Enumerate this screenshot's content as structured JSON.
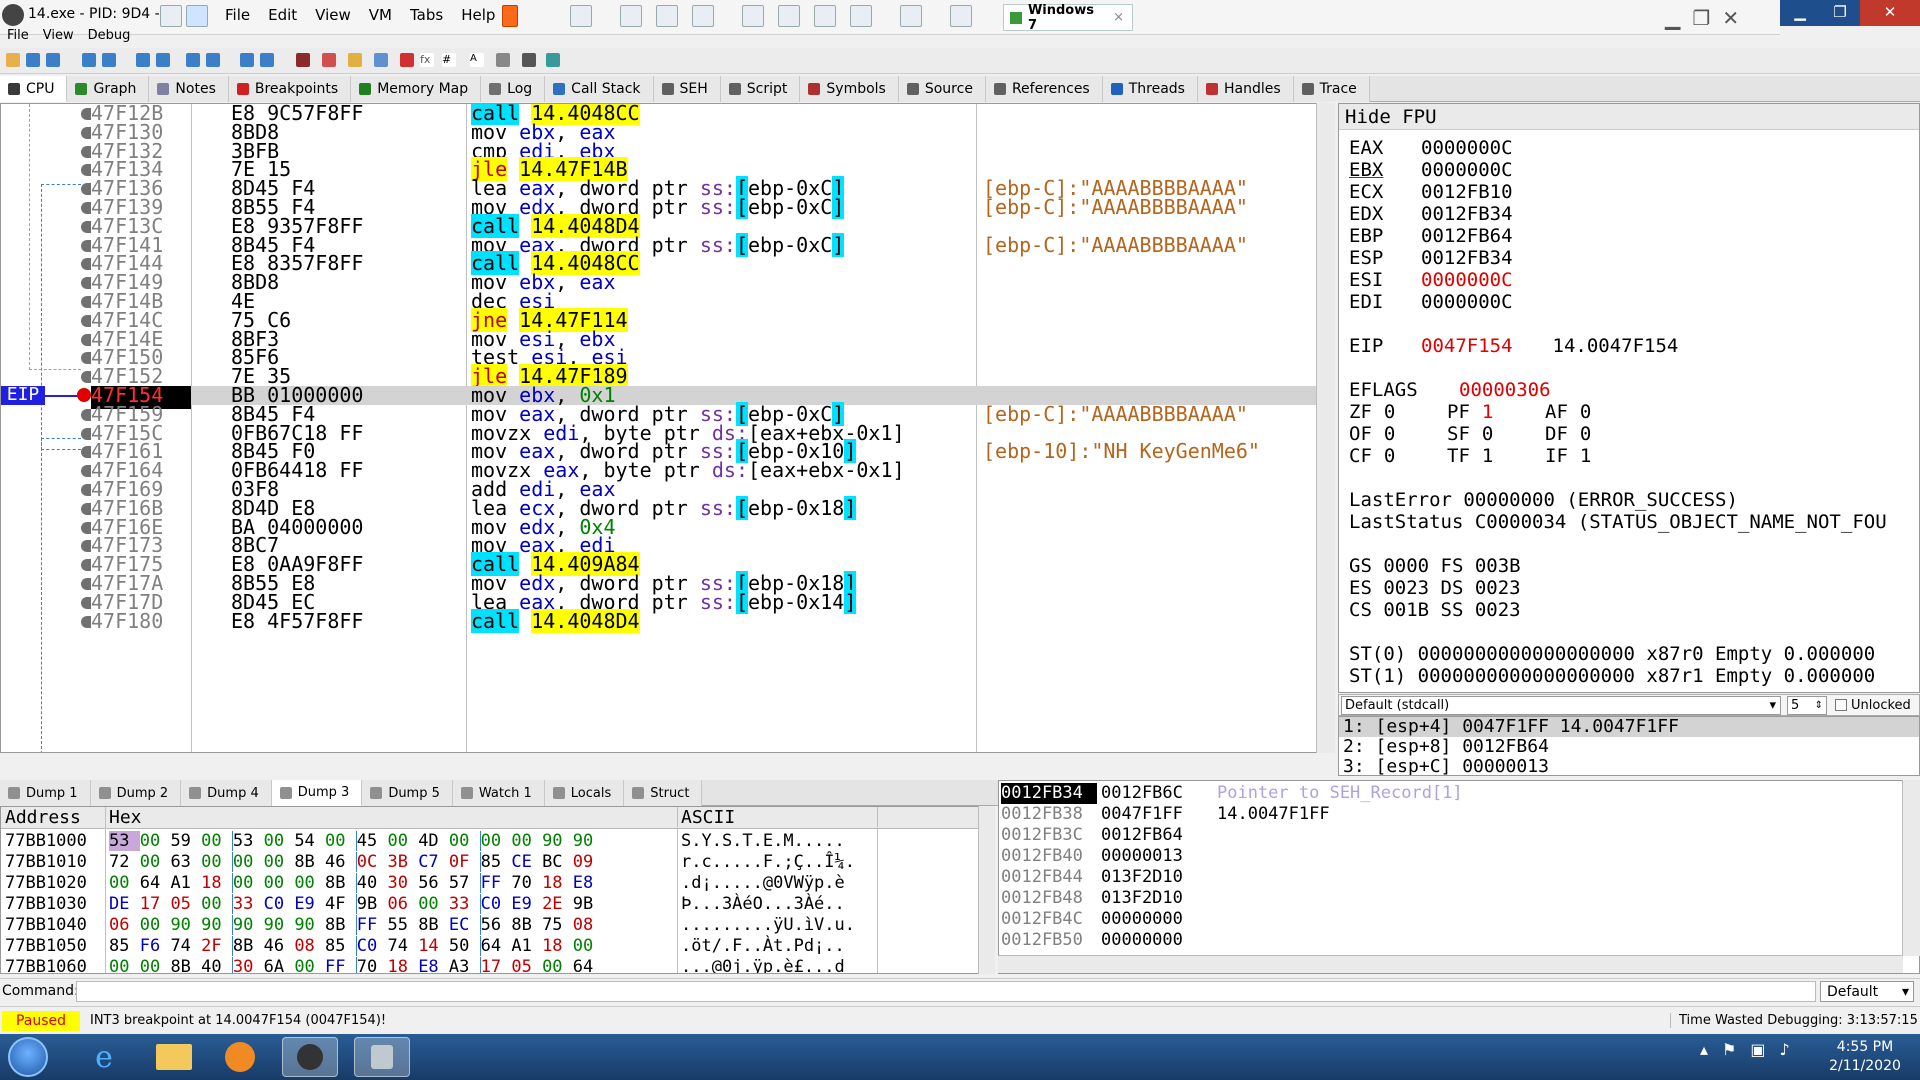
{
  "window": {
    "title": "14.exe - PID: 9D4 -",
    "menu": [
      "File",
      "Edit",
      "View",
      "VM",
      "Tabs",
      "Help"
    ],
    "vm_tab": "Windows 7"
  },
  "app_menu": [
    "File",
    "View",
    "Debug"
  ],
  "main_tabs": [
    {
      "label": "CPU",
      "icon": "cpu-icon",
      "color": "#3a3a3a"
    },
    {
      "label": "Graph",
      "icon": "graph-icon",
      "color": "#2a8a2a"
    },
    {
      "label": "Notes",
      "icon": "notes-icon",
      "color": "#8080a0"
    },
    {
      "label": "Breakpoints",
      "icon": "breakpoint-icon",
      "color": "#d02020"
    },
    {
      "label": "Memory Map",
      "icon": "memory-map-icon",
      "color": "#208020"
    },
    {
      "label": "Log",
      "icon": "log-icon",
      "color": "#707070"
    },
    {
      "label": "Call Stack",
      "icon": "call-stack-icon",
      "color": "#3070c0"
    },
    {
      "label": "SEH",
      "icon": "seh-icon",
      "color": "#606060"
    },
    {
      "label": "Script",
      "icon": "script-icon",
      "color": "#606060"
    },
    {
      "label": "Symbols",
      "icon": "symbols-icon",
      "color": "#b03030"
    },
    {
      "label": "Source",
      "icon": "source-icon",
      "color": "#606060"
    },
    {
      "label": "References",
      "icon": "references-icon",
      "color": "#606060"
    },
    {
      "label": "Threads",
      "icon": "threads-icon",
      "color": "#2060c0"
    },
    {
      "label": "Handles",
      "icon": "handles-icon",
      "color": "#c03030"
    },
    {
      "label": "Trace",
      "icon": "trace-icon",
      "color": "#606060"
    }
  ],
  "disasm": {
    "eip_label": "EIP",
    "rows": [
      {
        "addr": "47F12B",
        "bytes": "E8 9C57F8FF",
        "mn": "call",
        "op": "14.4048CC",
        "type": "call",
        "comment": ""
      },
      {
        "addr": "47F130",
        "bytes": "8BD8",
        "mn": "mov",
        "op": "ebx, eax",
        "type": "plain",
        "comment": ""
      },
      {
        "addr": "47F132",
        "bytes": "3BFB",
        "mn": "cmp",
        "op": "edi, ebx",
        "type": "plain",
        "comment": ""
      },
      {
        "addr": "47F134",
        "bytes": "7E 15",
        "mn": "jle",
        "op": "14.47F14B",
        "type": "jmp",
        "comment": ""
      },
      {
        "addr": "47F136",
        "bytes": "8D45 F4",
        "mn": "lea",
        "op": "eax, dword ptr ss:[ebp-0xC]",
        "type": "plain",
        "comment": "[ebp-C]:\"AAAABBBBAAAA\""
      },
      {
        "addr": "47F139",
        "bytes": "8B55 F4",
        "mn": "mov",
        "op": "edx, dword ptr ss:[ebp-0xC]",
        "type": "plain",
        "comment": "[ebp-C]:\"AAAABBBBAAAA\""
      },
      {
        "addr": "47F13C",
        "bytes": "E8 9357F8FF",
        "mn": "call",
        "op": "14.4048D4",
        "type": "call",
        "comment": ""
      },
      {
        "addr": "47F141",
        "bytes": "8B45 F4",
        "mn": "mov",
        "op": "eax, dword ptr ss:[ebp-0xC]",
        "type": "plain",
        "comment": "[ebp-C]:\"AAAABBBBAAAA\""
      },
      {
        "addr": "47F144",
        "bytes": "E8 8357F8FF",
        "mn": "call",
        "op": "14.4048CC",
        "type": "call",
        "comment": ""
      },
      {
        "addr": "47F149",
        "bytes": "8BD8",
        "mn": "mov",
        "op": "ebx, eax",
        "type": "plain",
        "comment": ""
      },
      {
        "addr": "47F14B",
        "bytes": "4E",
        "mn": "dec",
        "op": "esi",
        "type": "plain",
        "comment": ""
      },
      {
        "addr": "47F14C",
        "bytes": "75 C6",
        "mn": "jne",
        "op": "14.47F114",
        "type": "jmp",
        "comment": ""
      },
      {
        "addr": "47F14E",
        "bytes": "8BF3",
        "mn": "mov",
        "op": "esi, ebx",
        "type": "plain",
        "comment": ""
      },
      {
        "addr": "47F150",
        "bytes": "85F6",
        "mn": "test",
        "op": "esi, esi",
        "type": "plain",
        "comment": ""
      },
      {
        "addr": "47F152",
        "bytes": "7E 35",
        "mn": "jle",
        "op": "14.47F189",
        "type": "jmp",
        "comment": ""
      },
      {
        "addr": "47F154",
        "bytes": "BB 01000000",
        "mn": "mov",
        "op": "ebx, 0x1",
        "type": "plain",
        "comment": "",
        "eip": true
      },
      {
        "addr": "47F159",
        "bytes": "8B45 F4",
        "mn": "mov",
        "op": "eax, dword ptr ss:[ebp-0xC]",
        "type": "plain",
        "comment": "[ebp-C]:\"AAAABBBBAAAA\""
      },
      {
        "addr": "47F15C",
        "bytes": "0FB67C18 FF",
        "mn": "movzx",
        "op": "edi, byte ptr ds:[eax+ebx-0x1]",
        "type": "plain",
        "comment": ""
      },
      {
        "addr": "47F161",
        "bytes": "8B45 F0",
        "mn": "mov",
        "op": "eax, dword ptr ss:[ebp-0x10]",
        "type": "plain",
        "comment": "[ebp-10]:\"NH KeyGenMe6\""
      },
      {
        "addr": "47F164",
        "bytes": "0FB64418 FF",
        "mn": "movzx",
        "op": "eax, byte ptr ds:[eax+ebx-0x1]",
        "type": "plain",
        "comment": ""
      },
      {
        "addr": "47F169",
        "bytes": "03F8",
        "mn": "add",
        "op": "edi, eax",
        "type": "plain",
        "comment": ""
      },
      {
        "addr": "47F16B",
        "bytes": "8D4D E8",
        "mn": "lea",
        "op": "ecx, dword ptr ss:[ebp-0x18]",
        "type": "plain",
        "comment": ""
      },
      {
        "addr": "47F16E",
        "bytes": "BA 04000000",
        "mn": "mov",
        "op": "edx, 0x4",
        "type": "plain",
        "comment": ""
      },
      {
        "addr": "47F173",
        "bytes": "8BC7",
        "mn": "mov",
        "op": "eax, edi",
        "type": "plain",
        "comment": ""
      },
      {
        "addr": "47F175",
        "bytes": "E8 0AA9F8FF",
        "mn": "call",
        "op": "14.409A84",
        "type": "call",
        "comment": ""
      },
      {
        "addr": "47F17A",
        "bytes": "8B55 E8",
        "mn": "mov",
        "op": "edx, dword ptr ss:[ebp-0x18]",
        "type": "plain",
        "comment": ""
      },
      {
        "addr": "47F17D",
        "bytes": "8D45 EC",
        "mn": "lea",
        "op": "eax, dword ptr ss:[ebp-0x14]",
        "type": "plain",
        "comment": ""
      },
      {
        "addr": "47F180",
        "bytes": "E8 4F57F8FF",
        "mn": "call",
        "op": "14.4048D4",
        "type": "call",
        "comment": ""
      }
    ]
  },
  "registers": {
    "header": "Hide FPU",
    "gpr": [
      {
        "name": "EAX",
        "value": "0000000C",
        "changed": false
      },
      {
        "name": "EBX",
        "value": "0000000C",
        "changed": false
      },
      {
        "name": "ECX",
        "value": "0012FB10",
        "changed": false
      },
      {
        "name": "EDX",
        "value": "0012FB34",
        "changed": false
      },
      {
        "name": "EBP",
        "value": "0012FB64",
        "changed": false
      },
      {
        "name": "ESP",
        "value": "0012FB34",
        "changed": false
      },
      {
        "name": "ESI",
        "value": "0000000C",
        "changed": true
      },
      {
        "name": "EDI",
        "value": "0000000C",
        "changed": false
      }
    ],
    "eip": {
      "name": "EIP",
      "value": "0047F154",
      "label": "14.0047F154"
    },
    "eflags": {
      "name": "EFLAGS",
      "value": "00000306"
    },
    "flags_rows": [
      [
        {
          "n": "ZF",
          "v": "0"
        },
        {
          "n": "PF",
          "v": "1",
          "changed": true
        },
        {
          "n": "AF",
          "v": "0"
        }
      ],
      [
        {
          "n": "OF",
          "v": "0"
        },
        {
          "n": "SF",
          "v": "0"
        },
        {
          "n": "DF",
          "v": "0"
        }
      ],
      [
        {
          "n": "CF",
          "v": "0"
        },
        {
          "n": "TF",
          "v": "1"
        },
        {
          "n": "IF",
          "v": "1"
        }
      ]
    ],
    "last_error": "LastError  00000000 (ERROR_SUCCESS)",
    "last_status": "LastStatus C0000034 (STATUS_OBJECT_NAME_NOT_FOU",
    "segs": [
      "GS 0000  FS 003B",
      "ES 0023  DS 0023",
      "CS 001B  SS 0023"
    ],
    "fpu": [
      "ST(0) 0000000000000000000 x87r0 Empty 0.000000",
      "ST(1) 0000000000000000000 x87r1 Empty 0.000000"
    ]
  },
  "callconv": {
    "selected": "Default (stdcall)",
    "count": "5",
    "unlocked": "Unlocked"
  },
  "stack_args": [
    "1: [esp+4] 0047F1FF 14.0047F1FF",
    "2: [esp+8] 0012FB64",
    "3: [esp+C] 00000013"
  ],
  "dump_tabs": [
    {
      "label": "Dump 1",
      "active": false
    },
    {
      "label": "Dump 2",
      "active": false
    },
    {
      "label": "Dump 4",
      "active": false
    },
    {
      "label": "Dump 3",
      "active": true
    },
    {
      "label": "Dump 5",
      "active": false
    },
    {
      "label": "Watch 1",
      "active": false
    },
    {
      "label": "Locals",
      "active": false
    },
    {
      "label": "Struct",
      "active": false
    }
  ],
  "dump": {
    "col_address": "Address",
    "col_hex": "Hex",
    "col_ascii": "ASCII",
    "rows": [
      {
        "addr": "77BB1000",
        "hex": "53 00 59 00 53 00 54 00 45 00 4D 00 00 00 90 90",
        "ascii": "S.Y.S.T.E.M....."
      },
      {
        "addr": "77BB1010",
        "hex": "72 00 63 00 00 00 8B 46 0C 3B C7 0F 85 CE BC 09",
        "ascii": "r.c.....F.;Ç..Î¼."
      },
      {
        "addr": "77BB1020",
        "hex": "00 64 A1 18 00 00 00 8B 40 30 56 57 FF 70 18 E8",
        "ascii": ".d¡.....@0VWÿp.è"
      },
      {
        "addr": "77BB1030",
        "hex": "DE 17 05 00 33 C0 E9 4F 9B 06 00 33 C0 E9 2E 9B",
        "ascii": "Þ...3ÀéO...3Àé.."
      },
      {
        "addr": "77BB1040",
        "hex": "06 00 90 90 90 90 90 8B FF 55 8B EC 56 8B 75 08",
        "ascii": ".........ÿU.ìV.u."
      },
      {
        "addr": "77BB1050",
        "hex": "85 F6 74 2F 8B 46 08 85 C0 74 14 50 64 A1 18 00",
        "ascii": ".öt/.F..Àt.Pd¡.."
      },
      {
        "addr": "77BB1060",
        "hex": "00 00 8B 40 30 6A 00 FF 70 18 E8 A3 17 05 00 64",
        "ascii": "...@0j.ÿp.è£...d"
      }
    ]
  },
  "stack": {
    "rows": [
      {
        "addr": "0012FB34",
        "val": "0012FB6C",
        "comment": "Pointer to SEH_Record[1]",
        "top": true,
        "seh": true
      },
      {
        "addr": "0012FB38",
        "val": "0047F1FF",
        "comment": "14.0047F1FF"
      },
      {
        "addr": "0012FB3C",
        "val": "0012FB64",
        "comment": ""
      },
      {
        "addr": "0012FB40",
        "val": "00000013",
        "comment": ""
      },
      {
        "addr": "0012FB44",
        "val": "013F2D10",
        "comment": ""
      },
      {
        "addr": "0012FB48",
        "val": "013F2D10",
        "comment": ""
      },
      {
        "addr": "0012FB4C",
        "val": "00000000",
        "comment": ""
      },
      {
        "addr": "0012FB50",
        "val": "00000000",
        "comment": ""
      }
    ]
  },
  "command": {
    "label": "Command:",
    "value": "",
    "mode": "Default"
  },
  "status": {
    "state": "Paused",
    "message": "INT3 breakpoint at 14.0047F154 (0047F154)!",
    "time": "Time Wasted Debugging: 3:13:57:15"
  },
  "taskbar": {
    "apps": [
      "internet-explorer-icon",
      "folder-icon",
      "media-player-icon",
      "x64dbg-icon",
      "lock-icon"
    ],
    "time": "4:55 PM",
    "date": "2/11/2020"
  },
  "colors": {
    "accent_call": "#00e0ff",
    "accent_jump": "#ffff00",
    "eip_blue": "#2020e0",
    "changed_red": "#e00000",
    "comment_brown": "#b5651d"
  }
}
